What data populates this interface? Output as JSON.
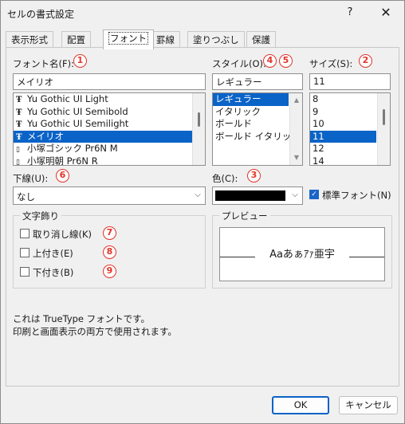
{
  "window": {
    "title": "セルの書式設定",
    "help": "?",
    "close": "✕"
  },
  "tabs": [
    "表示形式",
    "配置",
    "フォント",
    "罫線",
    "塗りつぶし",
    "保護"
  ],
  "font": {
    "label": "フォント名(F):",
    "value": "メイリオ",
    "items": [
      {
        "name": "Yu Gothic UI Light",
        "tt": true
      },
      {
        "name": "Yu Gothic UI Semibold",
        "tt": true
      },
      {
        "name": "Yu Gothic UI Semilight",
        "tt": true
      },
      {
        "name": "メイリオ",
        "tt": true,
        "selected": true
      },
      {
        "name": "小塚ゴシック Pr6N M",
        "tt": false
      },
      {
        "name": "小塚明朝 Pr6N R",
        "tt": false
      }
    ]
  },
  "style": {
    "label": "スタイル(O):",
    "value": "レギュラー",
    "items": [
      {
        "name": "レギュラー",
        "selected": true
      },
      {
        "name": "イタリック"
      },
      {
        "name": "ボールド"
      },
      {
        "name": "ボールド イタリック"
      }
    ]
  },
  "size": {
    "label": "サイズ(S):",
    "value": "11",
    "items": [
      {
        "name": "8"
      },
      {
        "name": "9"
      },
      {
        "name": "10"
      },
      {
        "name": "11",
        "selected": true
      },
      {
        "name": "12"
      },
      {
        "name": "14"
      }
    ]
  },
  "underline": {
    "label": "下線(U):",
    "value": "なし"
  },
  "color": {
    "label": "色(C):",
    "value_color": "#000000",
    "normal_font": "標準フォント(N)",
    "normal_font_checked": true
  },
  "effects": {
    "title": "文字飾り",
    "strikethrough": "取り消し線(K)",
    "superscript": "上付き(E)",
    "subscript": "下付き(B)"
  },
  "preview": {
    "title": "プレビュー",
    "text": "Aaあぁｱｧ亜宇"
  },
  "info": {
    "line1": "これは TrueType フォントです。",
    "line2": "印刷と画面表示の両方で使用されます。"
  },
  "buttons": {
    "ok": "OK",
    "cancel": "キャンセル"
  },
  "badges": [
    "1",
    "2",
    "3",
    "4",
    "5",
    "6",
    "7",
    "8",
    "9"
  ],
  "colors": {
    "accent": "#0a63c7",
    "badge": "#e2342a"
  }
}
